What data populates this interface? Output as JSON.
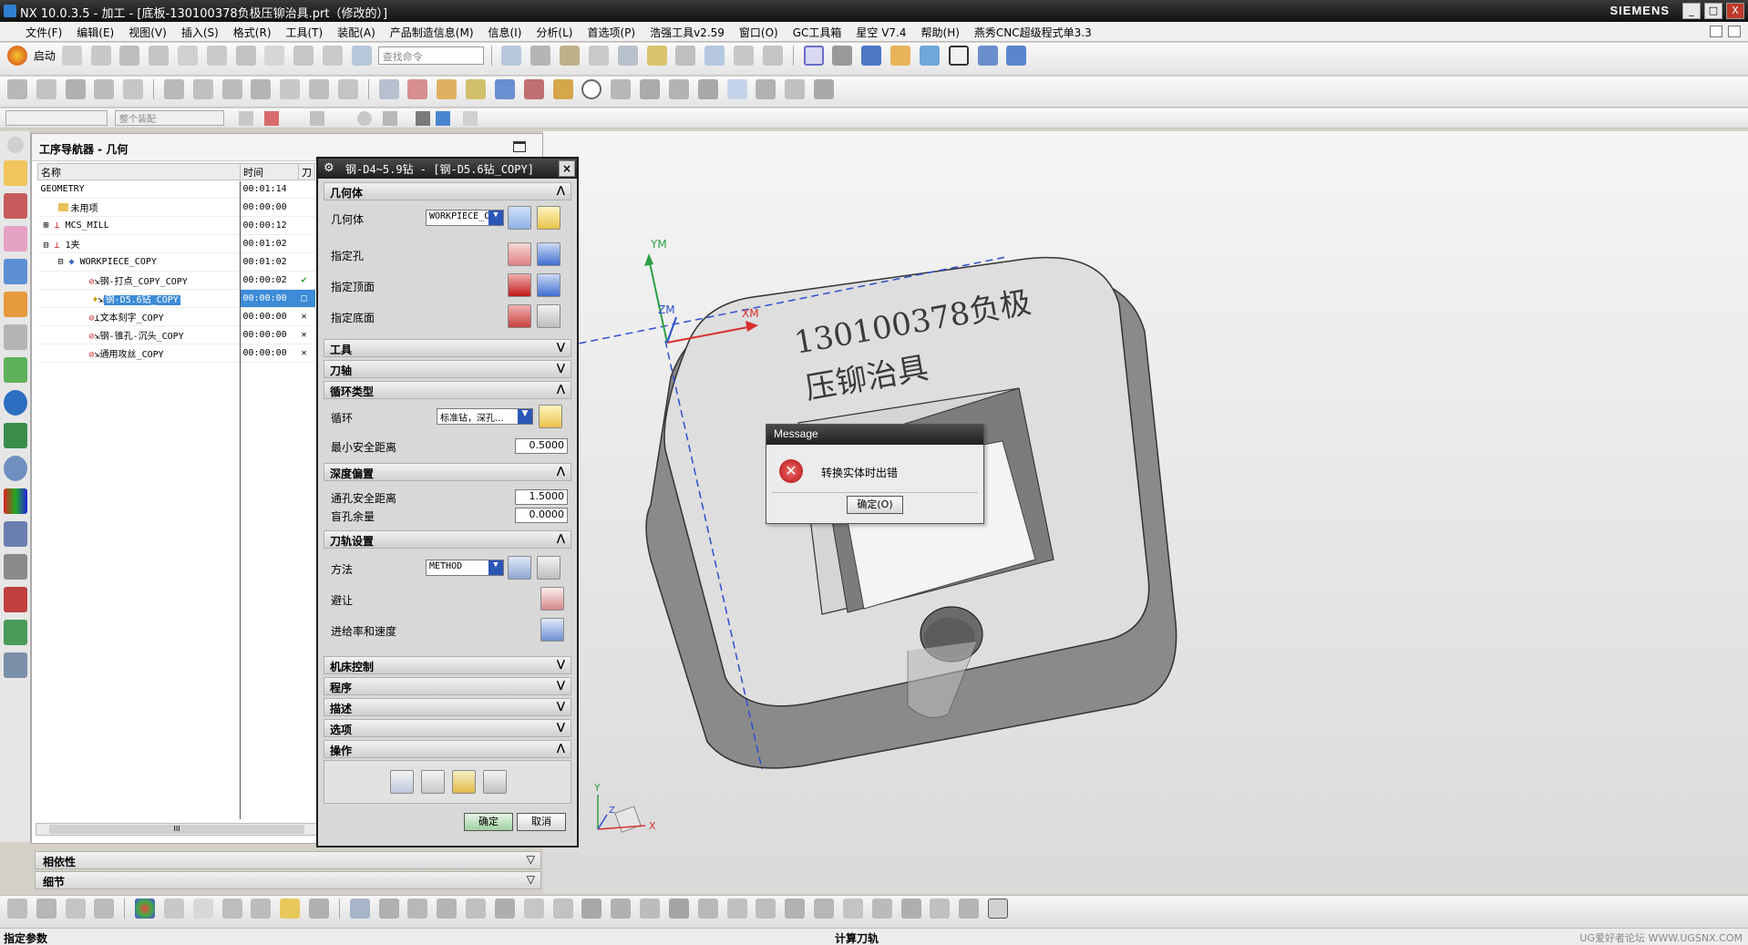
{
  "window": {
    "title": "NX 10.0.3.5 - 加工 - [底板-130100378负极压铆治具.prt（修改的）]",
    "brand": "SIEMENS",
    "controls": [
      "_",
      "□",
      "X"
    ]
  },
  "menu": [
    "文件(F)",
    "编辑(E)",
    "视图(V)",
    "插入(S)",
    "格式(R)",
    "工具(T)",
    "装配(A)",
    "产品制造信息(M)",
    "信息(I)",
    "分析(L)",
    "首选项(P)",
    "浩强工具v2.59",
    "窗口(O)",
    "GC工具箱",
    "星空 V7.4",
    "帮助(H)",
    "燕秀CNC超级程式单3.3"
  ],
  "toolbar": {
    "start_label": "启动",
    "search_placeholder": "查找命令",
    "assembly_filter": "整个装配"
  },
  "navigator": {
    "title": "工序导航器 - 几何",
    "columns": [
      "名称",
      "时间",
      "刀"
    ],
    "rows": [
      {
        "name": "GEOMETRY",
        "time": "00:01:14",
        "status": ""
      },
      {
        "name": "未用项",
        "time": "00:00:00",
        "status": ""
      },
      {
        "name": "MCS_MILL",
        "time": "00:00:12",
        "status": ""
      },
      {
        "name": "1夹",
        "time": "00:01:02",
        "status": ""
      },
      {
        "name": "WORKPIECE_COPY",
        "time": "00:01:02",
        "status": ""
      },
      {
        "name": "钢-打点_COPY_COPY",
        "time": "00:00:02",
        "status": "✔"
      },
      {
        "name": "钢-D5.6钻_COPY",
        "time": "00:00:00",
        "status": "□"
      },
      {
        "name": "文本刻字_COPY",
        "time": "00:00:00",
        "status": "✕"
      },
      {
        "name": "钢-锥孔-沉头_COPY",
        "time": "00:00:00",
        "status": "✕"
      },
      {
        "name": "通用攻丝_COPY",
        "time": "00:00:00",
        "status": "✕"
      }
    ],
    "scroll_label": "III",
    "panel_dependency": "相依性",
    "panel_details": "细节"
  },
  "dialog": {
    "title": "钢-D4~5.9钻 - [钢-D5.6钻_COPY]",
    "sections": {
      "geometry": "几何体",
      "tool": "工具",
      "axis": "刀轴",
      "cycle_type": "循环类型",
      "depth_offset": "深度偏置",
      "path_settings": "刀轨设置",
      "machine_control": "机床控制",
      "program": "程序",
      "description": "描述",
      "options": "选项",
      "actions": "操作"
    },
    "geometry_label": "几何体",
    "geometry_value": "WORKPIECE_C",
    "specify_hole": "指定孔",
    "specify_top": "指定顶面",
    "specify_bottom": "指定底面",
    "cycle_label": "循环",
    "cycle_value": "标准钻，深孔...",
    "min_clearance_label": "最小安全距离",
    "min_clearance_value": "0.5000",
    "through_clearance_label": "通孔安全距离",
    "through_clearance_value": "1.5000",
    "blind_stock_label": "盲孔余量",
    "blind_stock_value": "0.0000",
    "method_label": "方法",
    "method_value": "METHOD",
    "avoid_label": "避让",
    "feeds_label": "进给率和速度",
    "ok": "确定",
    "cancel": "取消"
  },
  "viewport": {
    "engraving_line1": "130100378负极",
    "engraving_line2": "压铆治具",
    "axis_y": "YM",
    "axis_x": "XM",
    "axis_z": "ZM",
    "triad_x": "X",
    "triad_y": "Y",
    "triad_z": "Z"
  },
  "message": {
    "title": "Message",
    "text": "转换实体时出错",
    "ok": "确定(O)"
  },
  "status": {
    "left": "指定参数",
    "center": "计算刀轨",
    "watermark": "UG爱好者论坛 WWW.UGSNX.COM"
  }
}
